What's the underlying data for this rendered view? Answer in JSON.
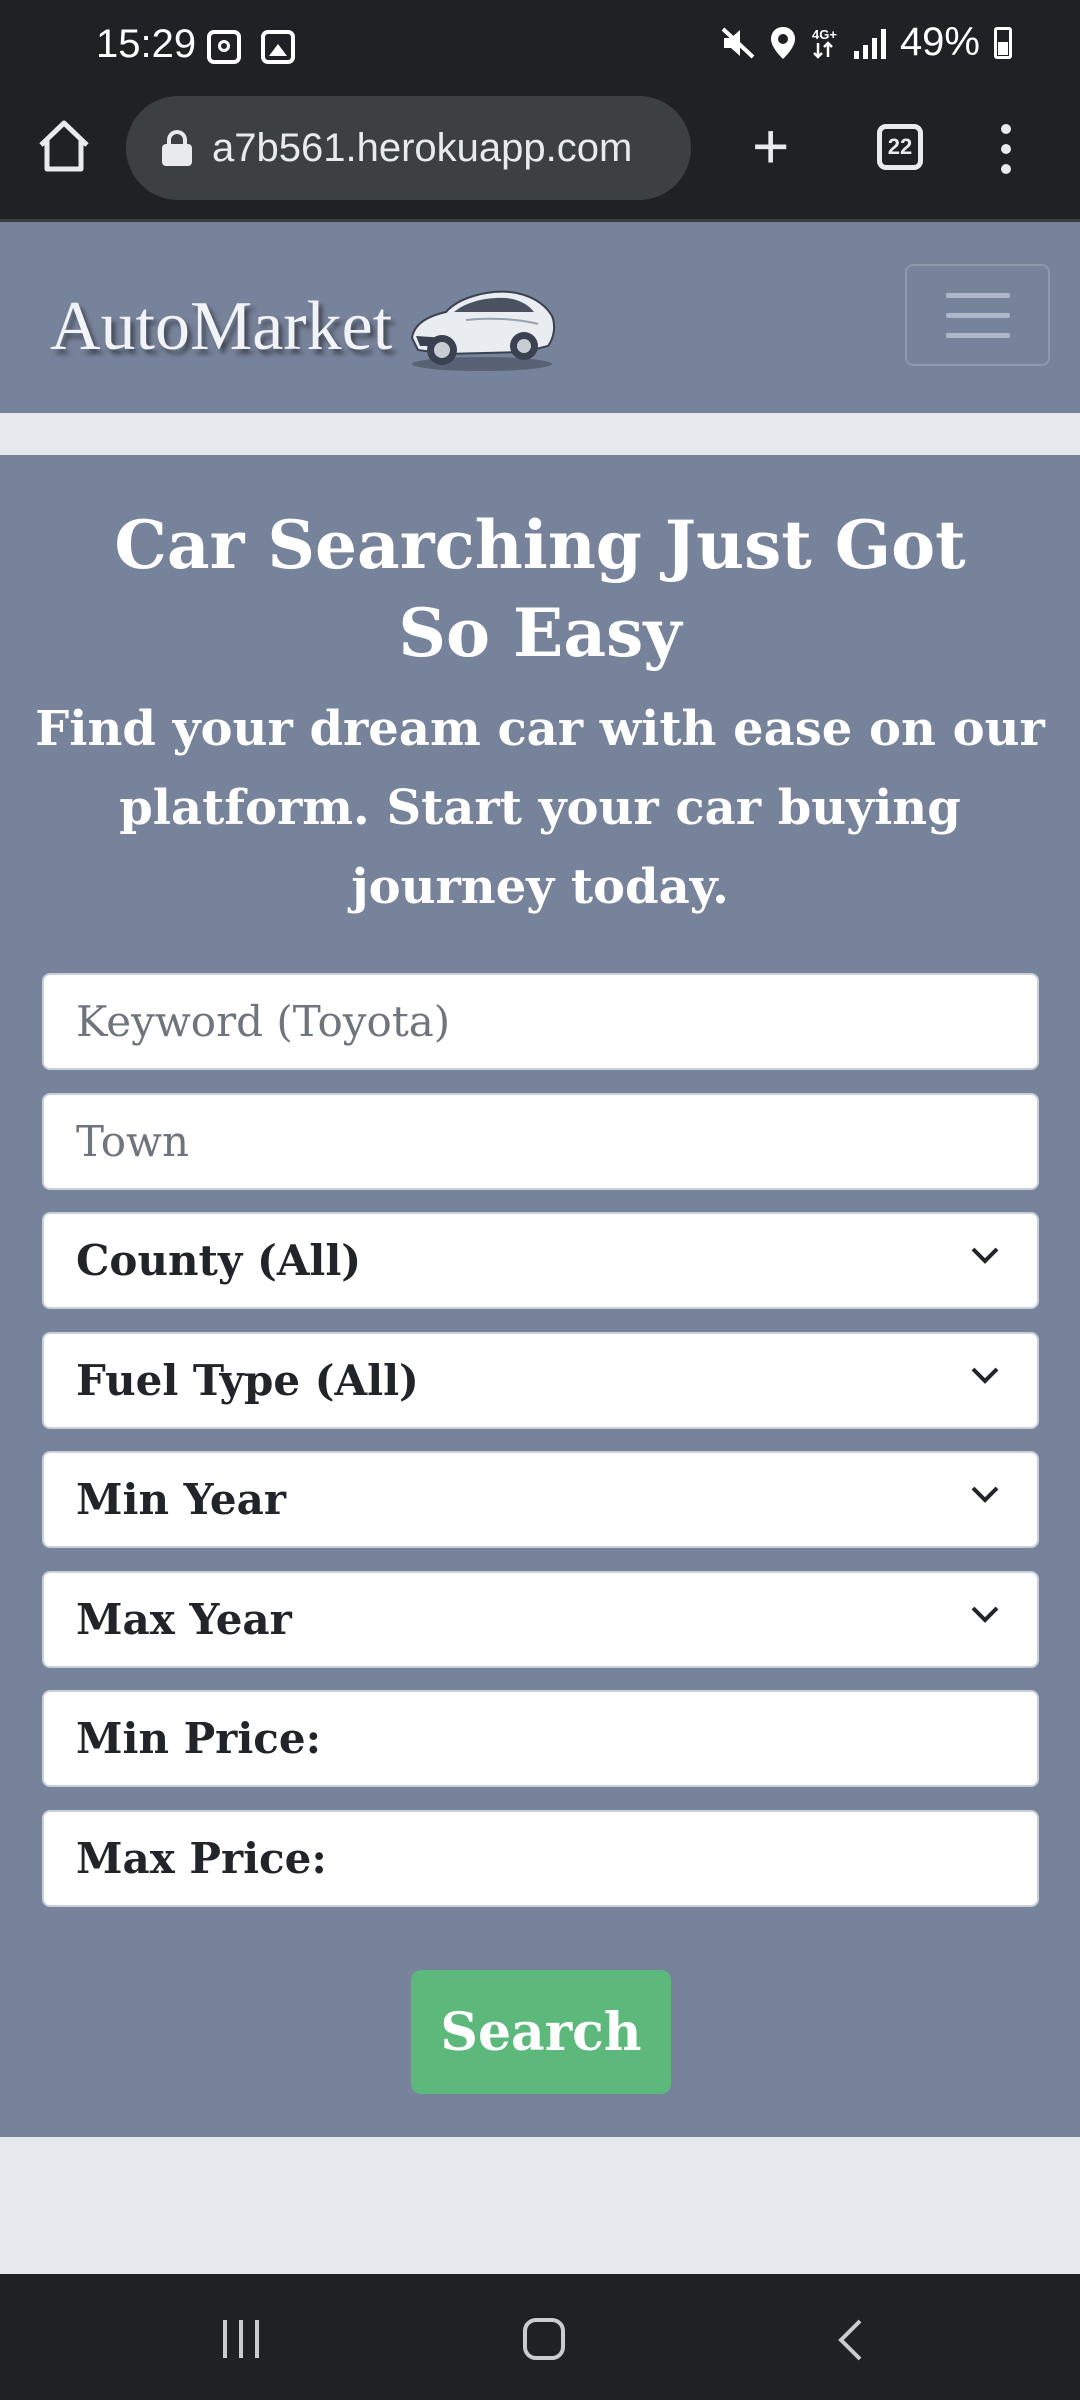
{
  "status_bar": {
    "time": "15:29",
    "battery": "49%"
  },
  "browser": {
    "url": "a7b561.herokuapp.com",
    "tab_count": "22"
  },
  "navbar": {
    "brand": "AutoMarket"
  },
  "hero": {
    "title": "Car Searching Just Got So Easy",
    "subtitle": "Find your dream car with ease on our platform. Start your car buying journey today."
  },
  "form": {
    "keyword_placeholder": "Keyword (Toyota)",
    "town_placeholder": "Town",
    "county": "County (All)",
    "fuel_type": "Fuel Type (All)",
    "min_year": "Min Year",
    "max_year": "Max Year",
    "min_price_label": "Min Price:",
    "max_price_label": "Max Price:",
    "search_label": "Search"
  },
  "colors": {
    "hero_bg": "#77839b",
    "search_button": "#5cb97b",
    "page_bg": "#e6e8ed"
  }
}
